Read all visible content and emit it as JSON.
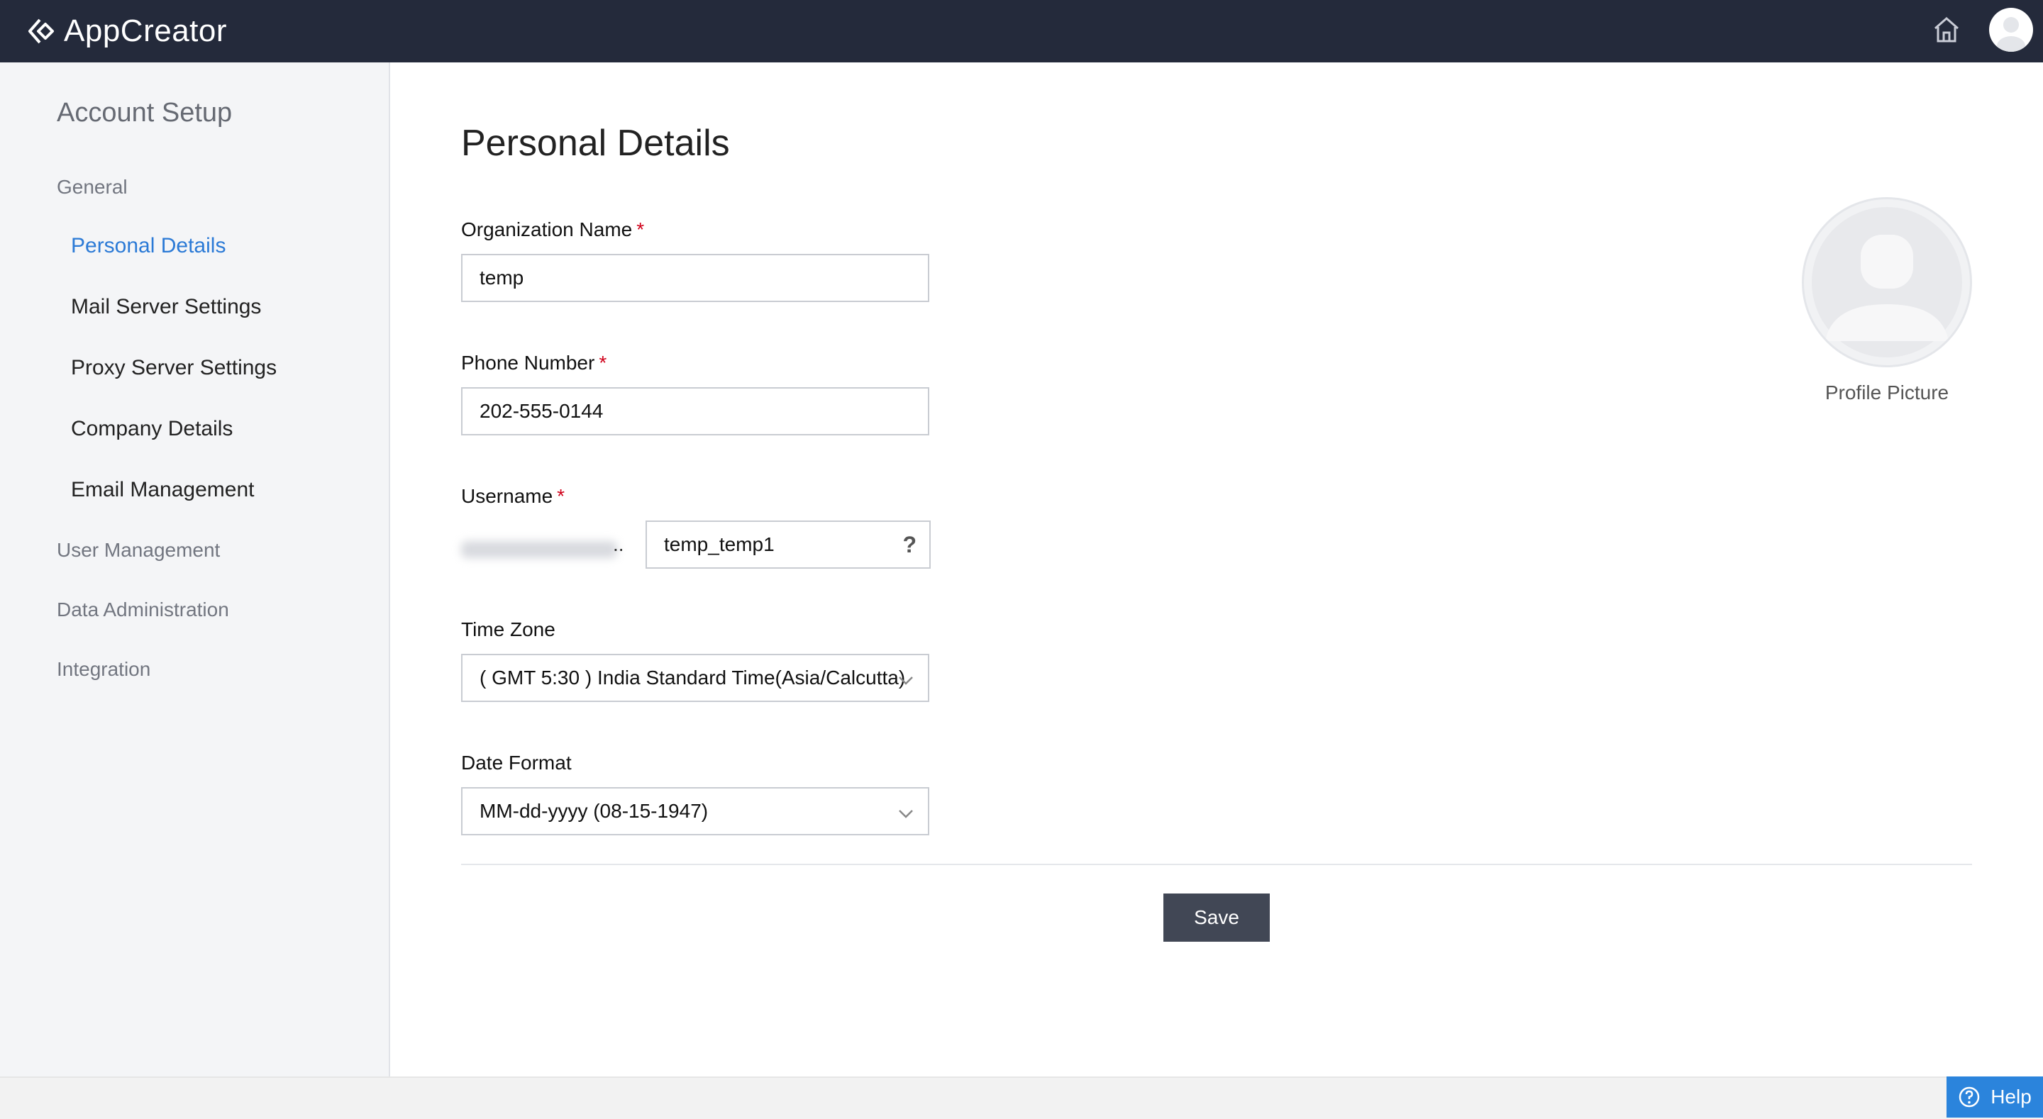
{
  "app": {
    "title": "AppCreator"
  },
  "sidebar": {
    "title": "Account Setup",
    "groups": [
      {
        "label": "General",
        "items": [
          {
            "label": "Personal Details",
            "active": true
          },
          {
            "label": "Mail Server Settings"
          },
          {
            "label": "Proxy Server Settings"
          },
          {
            "label": "Company Details"
          },
          {
            "label": "Email Management"
          }
        ]
      },
      {
        "label": "User Management"
      },
      {
        "label": "Data Administration"
      },
      {
        "label": "Integration"
      }
    ]
  },
  "main": {
    "title": "Personal Details",
    "fields": {
      "org_name": {
        "label": "Organization Name",
        "required": "*",
        "value": "temp"
      },
      "phone": {
        "label": "Phone Number",
        "required": "*",
        "value": "202-555-0144"
      },
      "username": {
        "label": "Username",
        "required": "*",
        "prefix_ellipsis": "..",
        "value": "temp_temp1",
        "help": "?"
      },
      "timezone": {
        "label": "Time Zone",
        "value": "( GMT 5:30 ) India Standard Time(Asia/Calcutta)"
      },
      "date_format": {
        "label": "Date Format",
        "value": "MM-dd-yyyy (08-15-1947)"
      }
    },
    "save_label": "Save",
    "profile_picture_label": "Profile Picture"
  },
  "footer": {
    "help_label": "Help"
  },
  "colors": {
    "topbar": "#242a3b",
    "accent": "#2b7ad6",
    "save": "#414755",
    "help": "#2b84dc",
    "required": "#d0021b"
  },
  "icons": {
    "logo": "appcreator-logo-icon",
    "home": "home-icon",
    "avatar": "user-avatar-icon",
    "chevron": "chevron-down-icon",
    "help": "help-circle-icon"
  }
}
